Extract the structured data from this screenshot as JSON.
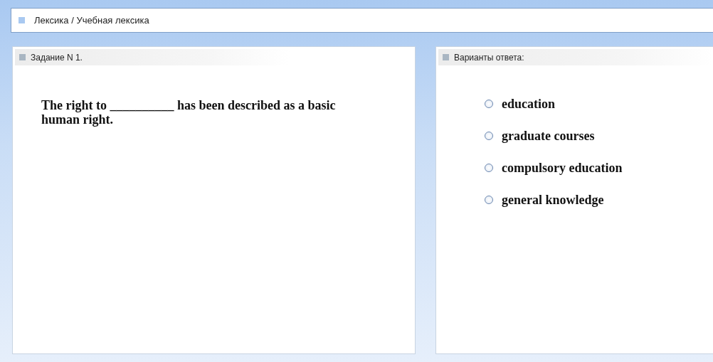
{
  "breadcrumb": "Лексика / Учебная лексика",
  "task_panel": {
    "title": "Задание N 1.",
    "question": "The right to __________ has been described as a basic human right."
  },
  "answers_panel": {
    "title": "Варианты ответа:",
    "options": [
      {
        "label": "education",
        "selected": false
      },
      {
        "label": "graduate courses",
        "selected": false
      },
      {
        "label": "compulsory education",
        "selected": false
      },
      {
        "label": "general knowledge",
        "selected": false
      }
    ]
  }
}
